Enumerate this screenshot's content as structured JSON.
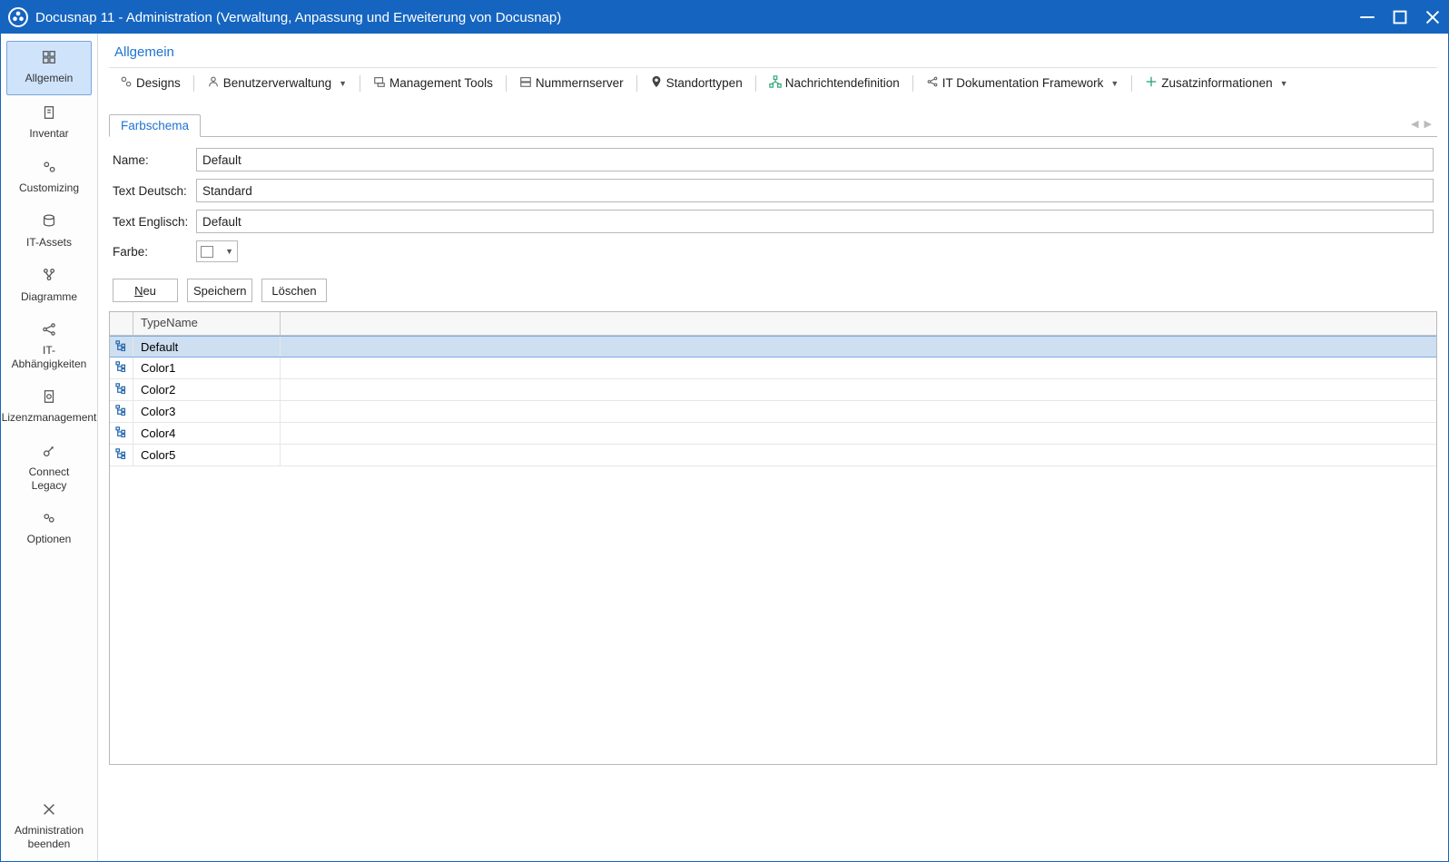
{
  "window": {
    "title": "Docusnap 11 - Administration (Verwaltung, Anpassung und Erweiterung von Docusnap)"
  },
  "sidebar": {
    "items": [
      {
        "label": "Allgemein",
        "selected": true
      },
      {
        "label": "Inventar",
        "selected": false
      },
      {
        "label": "Customizing",
        "selected": false
      },
      {
        "label": "IT-Assets",
        "selected": false
      },
      {
        "label": "Diagramme",
        "selected": false
      },
      {
        "label": "IT-Abhängigkeiten",
        "selected": false
      },
      {
        "label": "Lizenzmanagement",
        "selected": false
      },
      {
        "label": "Connect Legacy",
        "selected": false
      },
      {
        "label": "Optionen",
        "selected": false
      }
    ],
    "bottomItem": {
      "label": "Administration beenden"
    }
  },
  "page": {
    "title": "Allgemein"
  },
  "toolbar": {
    "items": [
      {
        "label": "Designs",
        "dropdown": false
      },
      {
        "label": "Benutzerverwaltung",
        "dropdown": true
      },
      {
        "label": "Management Tools",
        "dropdown": false
      },
      {
        "label": "Nummernserver",
        "dropdown": false
      },
      {
        "label": "Standorttypen",
        "dropdown": false
      },
      {
        "label": "Nachrichtendefinition",
        "dropdown": false
      },
      {
        "label": "IT Dokumentation Framework",
        "dropdown": true
      },
      {
        "label": "Zusatzinformationen",
        "dropdown": true
      }
    ]
  },
  "tabs": {
    "active": "Farbschema"
  },
  "form": {
    "name_label": "Name:",
    "name_value": "Default",
    "text_de_label": "Text Deutsch:",
    "text_de_value": "Standard",
    "text_en_label": "Text Englisch:",
    "text_en_value": "Default",
    "farbe_label": "Farbe:"
  },
  "actions": {
    "neu": "Neu",
    "speichern": "Speichern",
    "loeschen": "Löschen"
  },
  "grid": {
    "header": {
      "typename": "TypeName"
    },
    "rows": [
      {
        "typename": "Default",
        "selected": true
      },
      {
        "typename": "Color1",
        "selected": false
      },
      {
        "typename": "Color2",
        "selected": false
      },
      {
        "typename": "Color3",
        "selected": false
      },
      {
        "typename": "Color4",
        "selected": false
      },
      {
        "typename": "Color5",
        "selected": false
      }
    ]
  },
  "colors": {
    "accent": "#1565c0",
    "selection": "#cfe3fb"
  }
}
